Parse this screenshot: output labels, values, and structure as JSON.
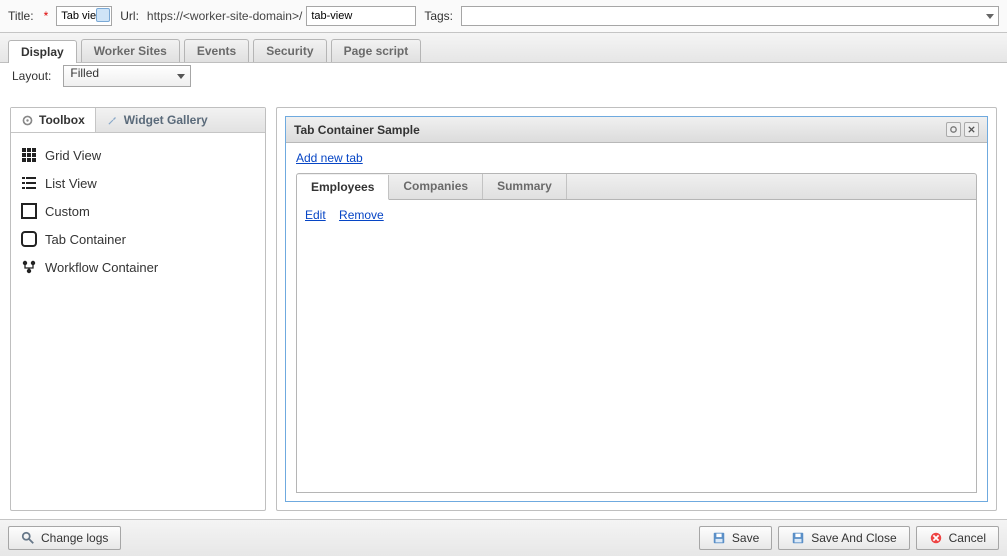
{
  "header": {
    "title_label": "Title:",
    "title_value": "Tab vie",
    "url_label": "Url:",
    "url_prefix": "https://<worker-site-domain>/",
    "url_value": "tab-view",
    "tags_label": "Tags:",
    "tags_value": ""
  },
  "main_tabs": [
    {
      "label": "Display",
      "active": true
    },
    {
      "label": "Worker Sites",
      "active": false
    },
    {
      "label": "Events",
      "active": false
    },
    {
      "label": "Security",
      "active": false
    },
    {
      "label": "Page script",
      "active": false
    }
  ],
  "layout": {
    "label": "Layout:",
    "value": "Filled"
  },
  "toolbox": {
    "tabs": [
      {
        "label": "Toolbox",
        "active": true,
        "icon": "gear-icon"
      },
      {
        "label": "Widget Gallery",
        "active": false,
        "icon": "wrench-icon"
      }
    ],
    "items": [
      {
        "label": "Grid View",
        "icon": "grid-icon"
      },
      {
        "label": "List View",
        "icon": "list-icon"
      },
      {
        "label": "Custom",
        "icon": "square-icon"
      },
      {
        "label": "Tab Container",
        "icon": "rounded-square-icon"
      },
      {
        "label": "Workflow Container",
        "icon": "workflow-icon"
      }
    ]
  },
  "preview": {
    "title": "Tab Container Sample",
    "add_link": "Add new tab",
    "inner_tabs": [
      {
        "label": "Employees",
        "active": true
      },
      {
        "label": "Companies",
        "active": false
      },
      {
        "label": "Summary",
        "active": false
      }
    ],
    "actions": {
      "edit": "Edit",
      "remove": "Remove"
    }
  },
  "footer": {
    "change_logs": "Change logs",
    "save": "Save",
    "save_close": "Save And Close",
    "cancel": "Cancel"
  }
}
